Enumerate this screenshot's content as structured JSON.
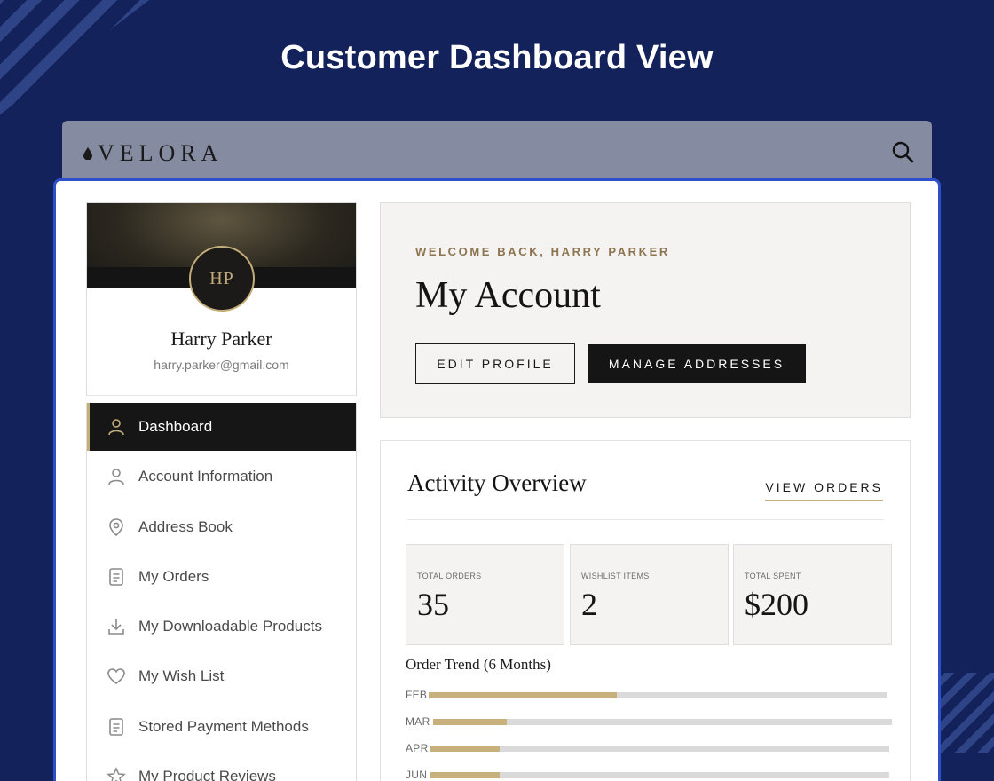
{
  "page_title": "Customer Dashboard View",
  "brand": {
    "name": "VELORA",
    "accent": "#c5ad7a",
    "dark": "#151515"
  },
  "profile": {
    "initials": "HP",
    "name": "Harry Parker",
    "email": "harry.parker@gmail.com"
  },
  "nav": {
    "items": [
      {
        "label": "Dashboard",
        "icon": "user-icon",
        "active": true
      },
      {
        "label": "Account Information",
        "icon": "user-icon"
      },
      {
        "label": "Address Book",
        "icon": "location-pin-icon"
      },
      {
        "label": "My Orders",
        "icon": "document-icon"
      },
      {
        "label": "My Downloadable Products",
        "icon": "download-icon"
      },
      {
        "label": "My Wish List",
        "icon": "heart-icon"
      },
      {
        "label": "Stored Payment Methods",
        "icon": "document-icon"
      },
      {
        "label": "My Product Reviews",
        "icon": "star-icon"
      }
    ]
  },
  "welcome": {
    "greeting": "WELCOME BACK, HARRY PARKER",
    "title": "My Account",
    "edit_profile": "EDIT PROFILE",
    "manage_addresses": "MANAGE ADDRESSES"
  },
  "activity": {
    "title": "Activity Overview",
    "view_orders": "VIEW ORDERS",
    "stats": [
      {
        "label": "TOTAL ORDERS",
        "value": "35"
      },
      {
        "label": "WISHLIST ITEMS",
        "value": "2"
      },
      {
        "label": "TOTAL SPENT",
        "value": "$200"
      }
    ],
    "trend_title": "Order Trend (6 Months)",
    "trend": [
      {
        "month": "FEB",
        "fraction": 0.41
      },
      {
        "month": "MAR",
        "fraction": 0.16
      },
      {
        "month": "APR",
        "fraction": 0.15
      },
      {
        "month": "JUN",
        "fraction": 0.15
      }
    ]
  }
}
